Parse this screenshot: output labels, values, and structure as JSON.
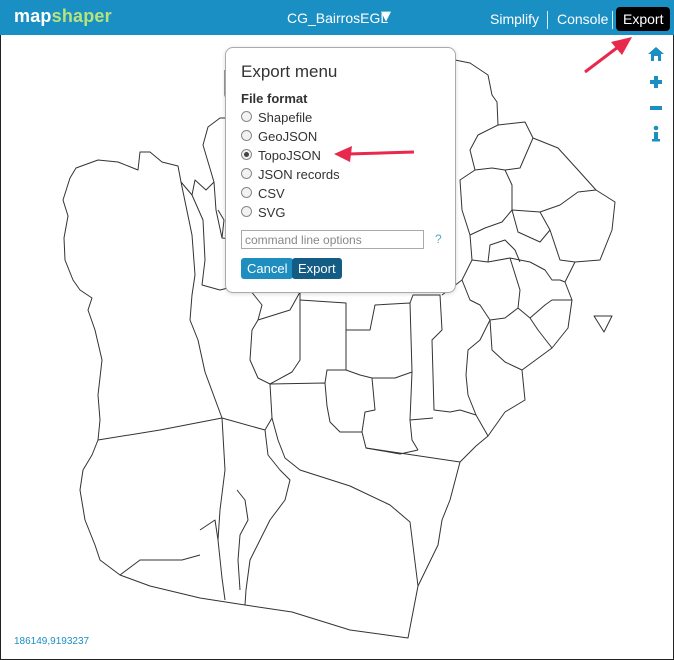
{
  "app": {
    "logo_part1": "map",
    "logo_part2": "shaper"
  },
  "header": {
    "layer_name": "CG_BairrosEGL",
    "layer_caret": "▼",
    "simplify_label": "Simplify",
    "console_label": "Console",
    "export_label": "Export"
  },
  "sidebar": {
    "icons": [
      "home-icon",
      "zoom-in-icon",
      "zoom-out-icon",
      "info-icon"
    ]
  },
  "status": {
    "coordinates": "186149,9193237"
  },
  "export_menu": {
    "title": "Export menu",
    "format_heading": "File format",
    "formats": [
      {
        "label": "Shapefile",
        "selected": false
      },
      {
        "label": "GeoJSON",
        "selected": false
      },
      {
        "label": "TopoJSON",
        "selected": true
      },
      {
        "label": "JSON records",
        "selected": false
      },
      {
        "label": "CSV",
        "selected": false
      },
      {
        "label": "SVG",
        "selected": false
      }
    ],
    "options_placeholder": "command line options",
    "help": "?",
    "cancel_label": "Cancel",
    "export_label": "Export"
  },
  "colors": {
    "header_bg": "#1a8fc3",
    "logo_accent": "#b6e37e",
    "export_active_bg": "#000000",
    "annotation_arrow": "#e8294d",
    "map_stroke": "#333333"
  }
}
